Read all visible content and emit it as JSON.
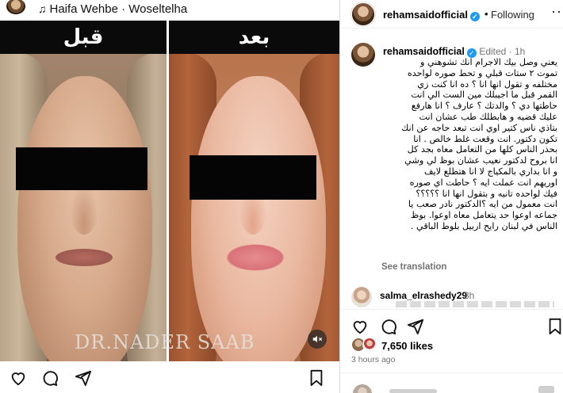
{
  "left": {
    "audio": {
      "note_icon": "music-note-icon",
      "text": "Haifa Wehbe · Woseltelha"
    },
    "media": {
      "before_label": "قبل",
      "after_label": "بعد",
      "watermark": "DR.NADER SAAB",
      "mute_icon": "speaker-muted-icon"
    },
    "actions": [
      "heart-icon",
      "comment-icon",
      "share-icon",
      "bookmark-icon"
    ]
  },
  "header": {
    "username": "rehamsaidofficial",
    "verified_icon": "verified-badge-icon",
    "separator": "•",
    "follow_status": "Following",
    "more_icon": "more-options-icon",
    "more_glyph": "···"
  },
  "caption": {
    "username": "rehamsaidofficial",
    "edited": "Edited · 1h",
    "body": "يعني وصل بيك الاجرام انك تشوهني و\nتموت ٢ ستات قبلي و تحط صوره لواحده\nمختلفه و تقول انها انا ؟ ده انا كنت زي\nالقمر قبل ما اجيبلك مين الست الي انت\nحاطتها دي ؟ والدتك ؟ عارف ؟ انا هارفع\nعليك قضيه و هابطلك طب عشان انت\nبتاذي ناس كتير اوي انت تبعد حاجه عن انك\nتكون دكتور. انت وقعت غلط خالص . انا\nبحذر الناس كلها من التعامل معاه بجد كل\nانا بروح لدكتور نعيب عشان بوظ لي وشي\nو انا بداري بالمكياج لا انا هتطلع لايف\nاوريهم انت عملت ايه ؟ حاطت اي صوره\nفيك لواحده تانيه و بتقول انها انا ؟؟؟؟؟\nانت معمول من ايه ؟الدكتور نادر صعب يا\nجماعه اوعوا حد يتعامل معاه اوعوا. بوظ\nالناس في لبنان رايح اربيل بلوط الباقي .",
    "see_translation": "See translation"
  },
  "comments": [
    {
      "username": "salma_elrashedy29",
      "time": "3h"
    }
  ],
  "actions": {
    "icons": [
      "heart-icon",
      "comment-icon",
      "share-icon",
      "bookmark-icon"
    ],
    "likes": "7,650 likes",
    "time_ago": "3 hours ago"
  },
  "colors": {
    "verified": "#1d9bf0",
    "secondary_text": "#737373",
    "border": "#dbdbdb"
  }
}
